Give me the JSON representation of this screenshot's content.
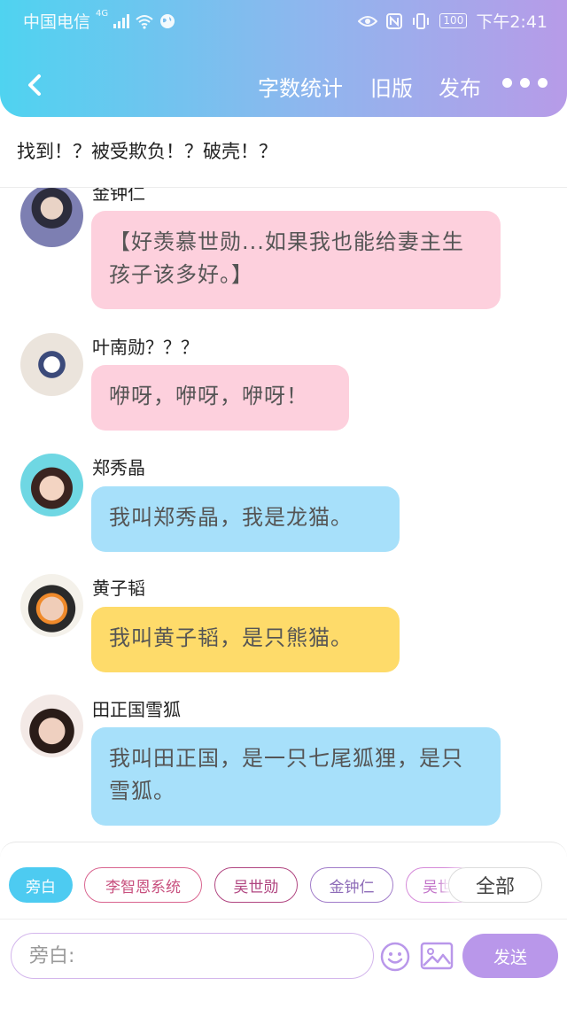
{
  "status_bar": {
    "carrier": "中国电信",
    "network": "4G",
    "battery": "100",
    "time": "下午2:41"
  },
  "nav": {
    "word_count": "字数统计",
    "old_version": "旧版",
    "publish": "发布"
  },
  "story_title": "找到！？被受欺负！？破壳！？",
  "messages": [
    {
      "name": "金钟仁",
      "text": "【好羡慕世勋...如果我也能给妻主生孩子该多好。】",
      "bubble_color": "#fdd0dd"
    },
    {
      "name": "叶南勋？？？",
      "text": "咿呀，咿呀，咿呀！",
      "bubble_color": "#fdd0dd"
    },
    {
      "name": "郑秀晶",
      "text": "我叫郑秀晶，我是龙猫。",
      "bubble_color": "#a7e0fa"
    },
    {
      "name": "黄子韬",
      "text": "我叫黄子韬，是只熊猫。",
      "bubble_color": "#fedb6a"
    },
    {
      "name": "田正国雪狐",
      "text": "我叫田正国，是一只七尾狐狸，是只雪狐。",
      "bubble_color": "#a7e0fa"
    }
  ],
  "characters": [
    "旁白",
    "李智恩系统",
    "吴世勋",
    "金钟仁",
    "吴世勋"
  ],
  "all_label": "全部",
  "input_placeholder": "旁白:",
  "send_label": "发送",
  "colors": {
    "accent_cyan": "#4dcbf1",
    "accent_purple": "#b997ea",
    "pink": "#fdd0dd",
    "blue": "#a7e0fa",
    "yellow": "#fedb6a"
  }
}
